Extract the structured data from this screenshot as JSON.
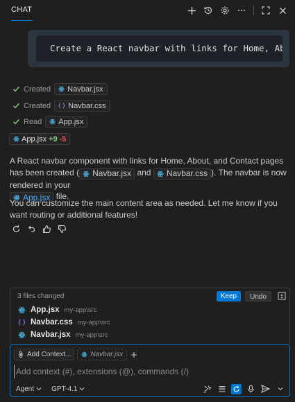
{
  "header": {
    "tab": "CHAT"
  },
  "prompt": {
    "text": "Create a React navbar with links for Home, About, and Contact pages"
  },
  "log": [
    {
      "verb": "Created",
      "file": "Navbar.jsx",
      "icon": "react-icon"
    },
    {
      "verb": "Created",
      "file": "Navbar.css",
      "icon": "css-braces-icon"
    },
    {
      "verb": "Read",
      "file": "App.jsx",
      "icon": "react-icon"
    }
  ],
  "summary": {
    "file": "App.jsx",
    "added": "+9",
    "removed": "-5"
  },
  "response": {
    "p1_a": "A React navbar component with links for Home, About, and Contact pages has been created (",
    "chip1": "Navbar.jsx",
    "p1_b": " and ",
    "chip2": "Navbar.css",
    "p1_c": "). The navbar is now rendered in your",
    "chip3": "App.jsx",
    "p1_d": " file.",
    "p2": "You can customize the main content area as needed. Let me know if you want routing or additional features!"
  },
  "changes": {
    "count": "3 files changed",
    "keep": "Keep",
    "undo": "Undo",
    "files": [
      {
        "name": "App.jsx",
        "path": "my-app\\src",
        "icon": "react-icon"
      },
      {
        "name": "Navbar.css",
        "path": "my-app\\src",
        "icon": "css-braces-icon"
      },
      {
        "name": "Navbar.jsx",
        "path": "my-app\\src",
        "icon": "react-icon"
      }
    ]
  },
  "input": {
    "add_context": "Add Context...",
    "context_file": "Navbar.jsx",
    "placeholder": "Add context (#), extensions (@), commands (/)",
    "mode": "Agent",
    "model": "GPT-4.1"
  },
  "colors": {
    "accent": "#0078d4",
    "react": "#4fc3f7",
    "css": "#9b8cf5",
    "added": "#89d185",
    "removed": "#f14c4c",
    "check": "#89d185"
  }
}
